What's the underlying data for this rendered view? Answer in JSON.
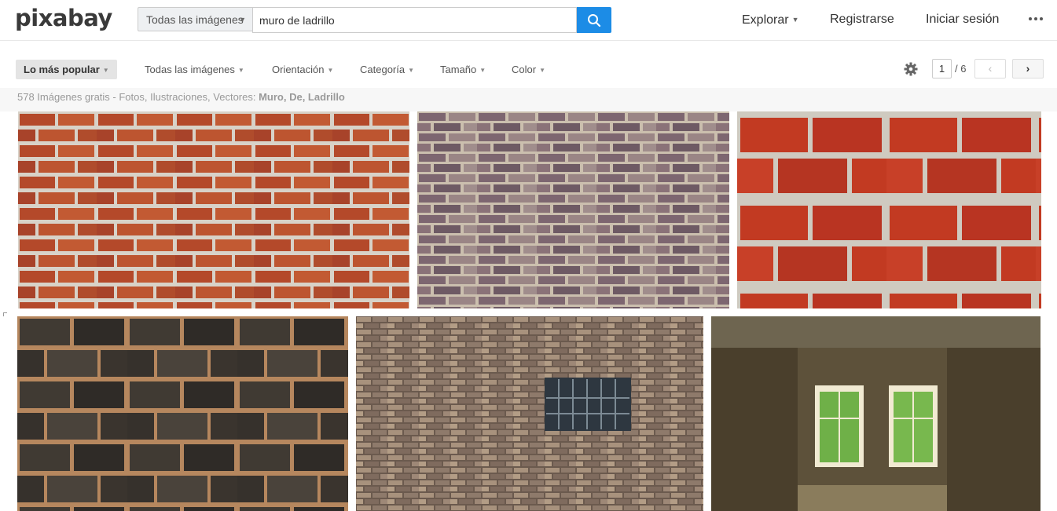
{
  "header": {
    "logo": "pixabay",
    "search": {
      "type_label": "Todas las imágenes",
      "value": "muro de ladrillo"
    },
    "nav": {
      "explore": "Explorar",
      "register": "Registrarse",
      "login": "Iniciar sesión"
    }
  },
  "filters": {
    "sort": "Lo más popular",
    "type": "Todas las imágenes",
    "orientation": "Orientación",
    "category": "Categoría",
    "size": "Tamaño",
    "color": "Color"
  },
  "pagination": {
    "current": "1",
    "total": "/ 6",
    "prev": "‹",
    "next": "›"
  },
  "results": {
    "summary_prefix": "578 Imágenes gratis - Fotos, Ilustraciones, Vectores: ",
    "terms": "Muro, De, Ladrillo"
  },
  "images": [
    {
      "description": "red brick wall",
      "tone": "#b9502a"
    },
    {
      "description": "grey purple brick wall",
      "tone": "#8f7a79"
    },
    {
      "description": "bright red brick wall",
      "tone": "#c33d26"
    },
    {
      "description": "dark stone block wall",
      "tone": "#3c3630"
    },
    {
      "description": "brick wall with barred window",
      "tone": "#8a7466"
    },
    {
      "description": "abandoned interior with windows",
      "tone": "#4a3d28"
    }
  ],
  "colors": {
    "accent": "#1c8ce6"
  }
}
